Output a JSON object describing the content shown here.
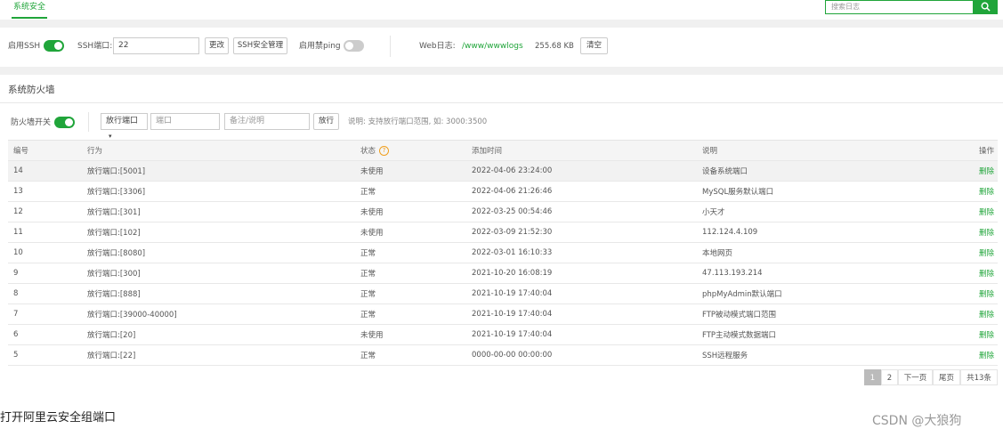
{
  "header": {
    "tab_security": "系统安全",
    "search_placeholder": "搜索日志"
  },
  "ssh_row": {
    "enable_ssh_label": "启用SSH",
    "ssh_port_label": "SSH端口:",
    "ssh_port_value": "22",
    "change_button": "更改",
    "ssh_manage_button": "SSH安全管理",
    "ping_label": "启用禁ping",
    "web_log_label": "Web日志:",
    "web_log_path": "/www/wwwlogs",
    "web_log_size": "255.68 KB",
    "clear_button": "清空"
  },
  "firewall": {
    "title": "系统防火墙",
    "switch_label": "防火墙开关",
    "rule_type": "放行端口",
    "port_placeholder": "端口",
    "note_placeholder": "备注/说明",
    "allow_button": "放行",
    "hint": "说明: 支持放行端口范围, 如: 3000:3500",
    "columns": [
      "编号",
      "行为",
      "状态",
      "添加时间",
      "说明",
      "操作"
    ],
    "rows": [
      {
        "id": "14",
        "action": "放行端口:[5001]",
        "status": "未使用",
        "time": "2022-04-06 23:24:00",
        "note": "设备系统端口",
        "op": "删除"
      },
      {
        "id": "13",
        "action": "放行端口:[3306]",
        "status": "正常",
        "time": "2022-04-06 21:26:46",
        "note": "MySQL服务默认端口",
        "op": "删除"
      },
      {
        "id": "12",
        "action": "放行端口:[301]",
        "status": "未使用",
        "time": "2022-03-25 00:54:46",
        "note": "小天才",
        "op": "删除"
      },
      {
        "id": "11",
        "action": "放行端口:[102]",
        "status": "未使用",
        "time": "2022-03-09 21:52:30",
        "note": "112.124.4.109",
        "op": "删除"
      },
      {
        "id": "10",
        "action": "放行端口:[8080]",
        "status": "正常",
        "time": "2022-03-01 16:10:33",
        "note": "本地网页",
        "op": "删除"
      },
      {
        "id": "9",
        "action": "放行端口:[300]",
        "status": "正常",
        "time": "2021-10-20 16:08:19",
        "note": "47.113.193.214",
        "op": "删除"
      },
      {
        "id": "8",
        "action": "放行端口:[888]",
        "status": "正常",
        "time": "2021-10-19 17:40:04",
        "note": "phpMyAdmin默认端口",
        "op": "删除"
      },
      {
        "id": "7",
        "action": "放行端口:[39000-40000]",
        "status": "正常",
        "time": "2021-10-19 17:40:04",
        "note": "FTP被动模式端口范围",
        "op": "删除"
      },
      {
        "id": "6",
        "action": "放行端口:[20]",
        "status": "未使用",
        "time": "2021-10-19 17:40:04",
        "note": "FTP主动模式数据端口",
        "op": "删除"
      },
      {
        "id": "5",
        "action": "放行端口:[22]",
        "status": "正常",
        "time": "0000-00-00 00:00:00",
        "note": "SSH远程服务",
        "op": "删除"
      }
    ]
  },
  "pagination": {
    "page1": "1",
    "page2": "2",
    "next": "下一页",
    "last": "尾页",
    "total": "共13条"
  },
  "footer": {
    "text": "打开阿里云安全组端口",
    "watermark": "CSDN @大狼狗"
  },
  "colors": {
    "accent": "#20a53a"
  }
}
